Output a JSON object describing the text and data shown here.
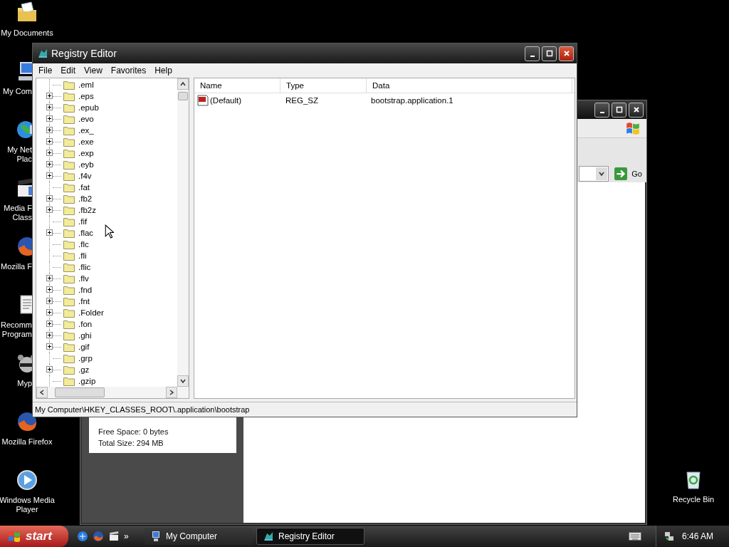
{
  "desktop_icons": [
    {
      "kind": "documents",
      "label": "My Documents",
      "clipped": false
    },
    {
      "kind": "computer",
      "label": "My Com",
      "clipped": true
    },
    {
      "kind": "network",
      "label": "My Net\nPlac",
      "clipped": true
    },
    {
      "kind": "clapper",
      "label": "Media F\nClass",
      "clipped": true
    },
    {
      "kind": "firefox",
      "label": "Mozilla F",
      "clipped": true
    },
    {
      "kind": "notepad",
      "label": "Recomm\nProgram",
      "clipped": true
    },
    {
      "kind": "raccoon",
      "label": "Myp",
      "clipped": true
    },
    {
      "kind": "firefox",
      "label": "Mozilla Firefox",
      "clipped": false
    },
    {
      "kind": "player",
      "label": "Windows Media\nPlayer",
      "clipped": false
    }
  ],
  "recycle_bin": {
    "label": "Recycle Bin"
  },
  "back_window": {
    "go_button": "Go",
    "details": [
      "Free Space: 0 bytes",
      "Total Size: 294 MB"
    ]
  },
  "registry_editor": {
    "title": "Registry Editor",
    "menu": [
      "File",
      "Edit",
      "View",
      "Favorites",
      "Help"
    ],
    "tree": [
      {
        "label": ".eml",
        "expandable": false
      },
      {
        "label": ".eps",
        "expandable": true
      },
      {
        "label": ".epub",
        "expandable": true
      },
      {
        "label": ".evo",
        "expandable": true
      },
      {
        "label": ".ex_",
        "expandable": true
      },
      {
        "label": ".exe",
        "expandable": true
      },
      {
        "label": ".exp",
        "expandable": true
      },
      {
        "label": ".eyb",
        "expandable": true
      },
      {
        "label": ".f4v",
        "expandable": true
      },
      {
        "label": ".fat",
        "expandable": false
      },
      {
        "label": ".fb2",
        "expandable": true
      },
      {
        "label": ".fb2z",
        "expandable": true
      },
      {
        "label": ".fif",
        "expandable": false
      },
      {
        "label": ".flac",
        "expandable": true
      },
      {
        "label": ".flc",
        "expandable": false
      },
      {
        "label": ".fli",
        "expandable": false
      },
      {
        "label": ".flic",
        "expandable": false
      },
      {
        "label": ".flv",
        "expandable": true
      },
      {
        "label": ".fnd",
        "expandable": true
      },
      {
        "label": ".fnt",
        "expandable": true
      },
      {
        "label": ".Folder",
        "expandable": true
      },
      {
        "label": ".fon",
        "expandable": true
      },
      {
        "label": ".ghi",
        "expandable": true
      },
      {
        "label": ".gif",
        "expandable": true
      },
      {
        "label": ".grp",
        "expandable": false
      },
      {
        "label": ".gz",
        "expandable": true
      },
      {
        "label": ".gzip",
        "expandable": false
      }
    ],
    "columns": [
      "Name",
      "Type",
      "Data"
    ],
    "values": [
      {
        "name": "(Default)",
        "type": "REG_SZ",
        "data": "bootstrap.application.1"
      }
    ],
    "status_bar": "My Computer\\HKEY_CLASSES_ROOT\\.application\\bootstrap"
  },
  "taskbar": {
    "start": "start",
    "chevron": "»",
    "tasks": [
      {
        "label": "My Computer",
        "kind": "computer",
        "selected": false
      },
      {
        "label": "Registry Editor",
        "kind": "registry",
        "selected": true
      }
    ],
    "clock": "6:46 AM"
  }
}
